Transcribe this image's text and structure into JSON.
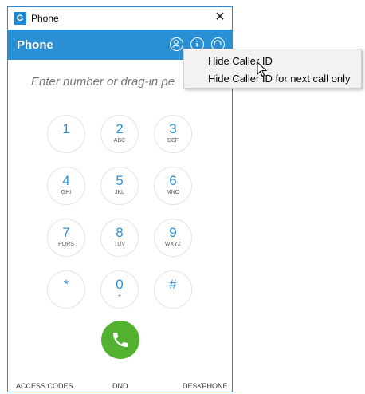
{
  "window": {
    "title": "Phone",
    "app_icon_glyph": "G",
    "close_glyph": "✕"
  },
  "header": {
    "title": "Phone",
    "icons": [
      "caller-id-icon",
      "info-icon",
      "headset-icon"
    ]
  },
  "dialer": {
    "placeholder": "Enter number or drag-in pe",
    "keys": [
      {
        "digit": "1",
        "letters": ""
      },
      {
        "digit": "2",
        "letters": "ABC"
      },
      {
        "digit": "3",
        "letters": "DEF"
      },
      {
        "digit": "4",
        "letters": "GHI"
      },
      {
        "digit": "5",
        "letters": "JKL"
      },
      {
        "digit": "6",
        "letters": "MNO"
      },
      {
        "digit": "7",
        "letters": "PQRS"
      },
      {
        "digit": "8",
        "letters": "TUV"
      },
      {
        "digit": "9",
        "letters": "WXYZ"
      },
      {
        "digit": "*",
        "letters": ""
      },
      {
        "digit": "0",
        "letters": "+"
      },
      {
        "digit": "#",
        "letters": ""
      }
    ],
    "call_color": "#53b130"
  },
  "footer": {
    "access_codes": "ACCESS CODES",
    "dnd": "DND",
    "deskphone": "DESKPHONE"
  },
  "context_menu": {
    "items": [
      {
        "label": "Hide Caller ID"
      },
      {
        "label": "Hide Caller ID for next call only"
      }
    ]
  },
  "colors": {
    "accent": "#2b8fd3",
    "call": "#53b130"
  }
}
